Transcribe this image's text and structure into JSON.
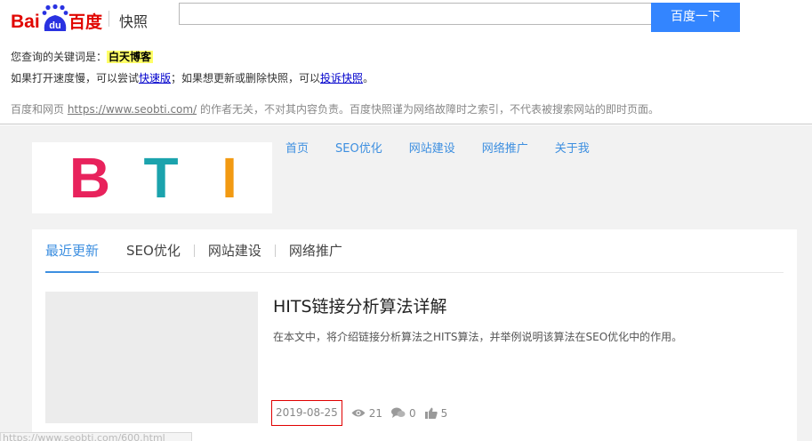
{
  "colors": {
    "baidu_blue": "#3385ff",
    "baidu_red": "#e10601",
    "site_accent": "#3d8fe0",
    "highlight": "#ffff66",
    "logo_b": "#e8225c",
    "logo_t": "#1ba3ad",
    "logo_i": "#f29a12"
  },
  "baidu": {
    "logo_text_latin": "Bai",
    "logo_text_du": "du",
    "logo_text_cn": "百度",
    "kuaizhao": "快照",
    "search": {
      "value": "",
      "placeholder": ""
    },
    "search_button": "百度一下",
    "query_prefix": "您查询的关键词是：",
    "query_keyword": "白天博客",
    "notice_1": "如果打开速度慢，可以尝试",
    "link_fast": "快速版",
    "notice_2": "；如果想更新或删除快照，可以",
    "link_complain": "投诉快照",
    "notice_3": "。",
    "disclaimer_1": "百度和网页 ",
    "disclaimer_url": "https://www.seobti.com/",
    "disclaimer_2": " 的作者无关，不对其内容负责。百度快照谨为网络故障时之索引，不代表被搜索网站的即时页面。"
  },
  "site": {
    "logo_letters": [
      "B",
      "T",
      "I"
    ],
    "nav": [
      "首页",
      "SEO优化",
      "网站建设",
      "网络推广",
      "关于我"
    ],
    "tabs": [
      "最近更新",
      "SEO优化",
      "网站建设",
      "网络推广"
    ],
    "active_tab": 0,
    "post": {
      "title": "HITS链接分析算法详解",
      "excerpt": "在本文中，将介绍链接分析算法之HITS算法，并举例说明该算法在SEO优化中的作用。",
      "date": "2019-08-25",
      "views": "21",
      "comments": "0",
      "likes": "5"
    }
  },
  "status_bar_url": "https://www.seobti.com/600.html"
}
